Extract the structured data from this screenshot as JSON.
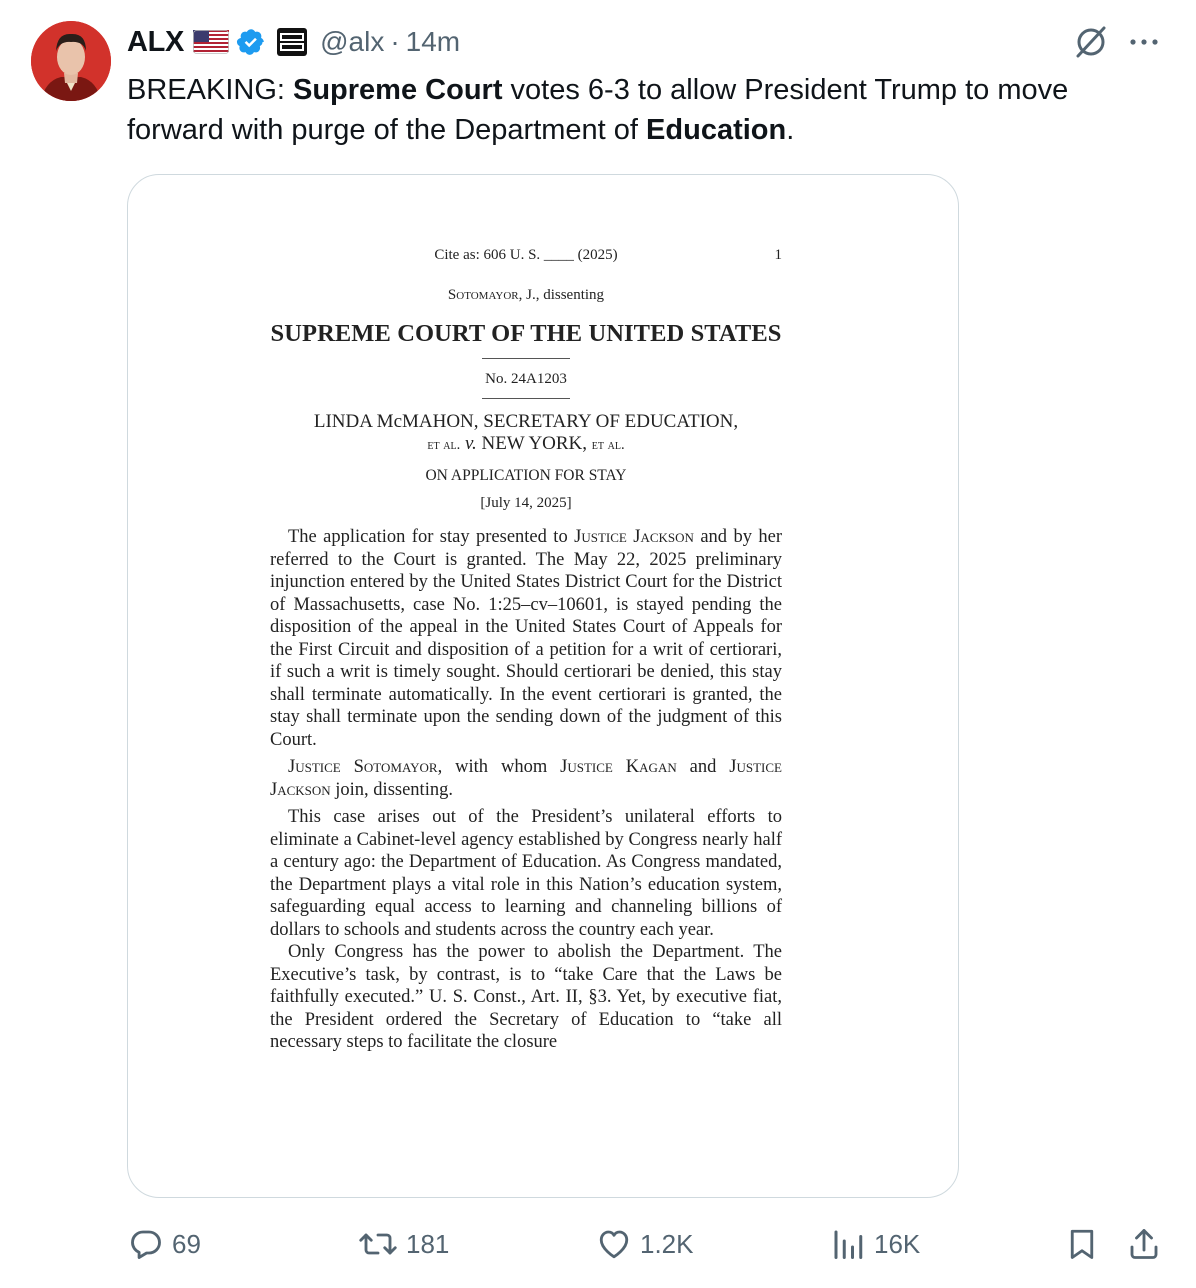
{
  "author": {
    "name": "ALX",
    "handle": "@alx",
    "separator": "·",
    "time": "14m"
  },
  "tweet": {
    "prefix": "BREAKING: ",
    "bold1": "Supreme Court",
    "middle": " votes 6-3 to allow President Trump to move forward with purge of the Department of ",
    "bold2": "Education",
    "suffix": "."
  },
  "document": {
    "cite": "Cite as:  606 U. S. ____ (2025)",
    "page_number": "1",
    "dissent_name": "Sotomayor",
    "dissent_rest": ", J., dissenting",
    "court": "SUPREME COURT OF THE UNITED STATES",
    "docket": "No. 24A1203",
    "party_line1": "LINDA McMAHON, SECRETARY OF EDUCATION,",
    "party_etal1": "et al.",
    "party_v": "v.",
    "party_ny": "NEW YORK,",
    "party_etal2": "et al.",
    "application": "ON APPLICATION FOR STAY",
    "date": "[July 14, 2025]",
    "p1_start": "The application for stay presented to ",
    "p1_justice": "Justice Jackson",
    "p1_rest": " and by her referred to the Court is granted.  The May 22, 2025 preliminary injunction entered by the United States District Court for the District of Massachusetts, case No. 1:25–cv–10601, is stayed pending the disposition of the appeal in the United States Court of Appeals for the First Circuit and disposition of a petition for a writ of certiorari, if such a writ is timely sought.  Should certiorari be denied, this stay shall terminate automatically.  In the event certiorari is granted, the stay shall terminate upon the sending down of the judgment of this Court.",
    "p2_j1": "Justice Sotomayor",
    "p2_mid": ", with whom ",
    "p2_j2": "Justice Kagan",
    "p2_and": " and ",
    "p2_j3": "Justice Jackson",
    "p2_end": " join, dissenting.",
    "p3": "This case arises out of the President’s unilateral efforts to eliminate a Cabinet-level agency established by Congress nearly half a century ago: the Department of Education.  As Congress mandated, the Department plays a vital role in this Nation’s education system, safeguarding equal access to learning and channeling billions of dollars to schools and students across the country each year.",
    "p4": "Only Congress has the power to abolish the Department. The Executive’s task, by contrast, is to “take Care that the Laws be faithfully executed.”  U. S. Const., Art. II, §3.  Yet, by executive fiat, the President ordered the Secretary of Education to “take all necessary steps to facilitate the closure"
  },
  "actions": {
    "replies": "69",
    "reposts": "181",
    "likes": "1.2K",
    "views": "16K"
  },
  "colors": {
    "text": "#0f1419",
    "muted": "#536471",
    "verified": "#1d9bf0",
    "border": "#cfd9de"
  },
  "icons": [
    "flag-icon",
    "verified-icon",
    "affiliate-badge-icon",
    "grok-icon",
    "more-icon",
    "reply-icon",
    "repost-icon",
    "like-icon",
    "views-icon",
    "bookmark-icon",
    "share-icon"
  ]
}
